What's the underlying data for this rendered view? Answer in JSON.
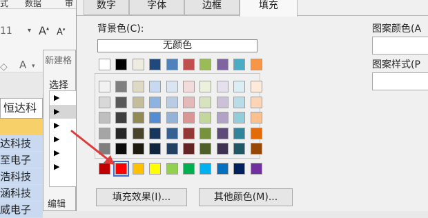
{
  "excel": {
    "ribbon_tabs": [
      "式",
      "数据",
      "审"
    ],
    "font_size": "11",
    "sub_dialog_title": "新建格",
    "sub_select_label": "选择",
    "sub_edit_label": "编辑",
    "cell_name": "恒达科",
    "cells": [
      "达科技",
      "至电子",
      "浩科技",
      "涵科技",
      "威电子"
    ]
  },
  "dialog": {
    "tabs": [
      {
        "label": "数字",
        "active": false
      },
      {
        "label": "字体",
        "active": false
      },
      {
        "label": "边框",
        "active": false
      },
      {
        "label": "填充",
        "active": true
      }
    ],
    "background_color_label": "背景色(C):",
    "no_color_label": "无颜色",
    "pattern_color_label": "图案颜色(A",
    "pattern_style_label": "图案样式(P",
    "fill_effects_button": "填充效果(I)...",
    "more_colors_button": "其他颜色(M)...",
    "palette_top": [
      "#ffffff",
      "#000000",
      "#eeece1",
      "#1f497d",
      "#4f81bd",
      "#c0504d",
      "#9bbb59",
      "#8064a2",
      "#4bacc6",
      "#f79646"
    ],
    "palette_shades": [
      [
        "#f2f2f2",
        "#7f7f7f",
        "#ddd9c3",
        "#c6d9f0",
        "#dbe5f1",
        "#f2dcdb",
        "#ebf1dd",
        "#e5e0ec",
        "#dbeef3",
        "#fdeada"
      ],
      [
        "#d8d8d8",
        "#595959",
        "#c4bd97",
        "#8db3e2",
        "#b8cce4",
        "#e5b9b7",
        "#d7e3bc",
        "#ccc1d9",
        "#b7dde8",
        "#fbd5b5"
      ],
      [
        "#bfbfbf",
        "#3f3f3f",
        "#938953",
        "#548dd4",
        "#95b3d7",
        "#d99694",
        "#c3d69b",
        "#b2a2c7",
        "#92cddc",
        "#fac08f"
      ],
      [
        "#a5a5a5",
        "#262626",
        "#494429",
        "#17365d",
        "#366092",
        "#953734",
        "#76923c",
        "#5f497a",
        "#31859b",
        "#e36c09"
      ],
      [
        "#7f7f7f",
        "#0c0c0c",
        "#1d1b10",
        "#0f243e",
        "#244061",
        "#632423",
        "#4f6128",
        "#3f3151",
        "#205867",
        "#974806"
      ]
    ],
    "palette_standard": [
      "#c00000",
      "#ff0000",
      "#ffc000",
      "#ffff00",
      "#92d050",
      "#00b050",
      "#00b0f0",
      "#0070c0",
      "#002060",
      "#7030a0"
    ],
    "selected_standard_color": "#ff0000",
    "annotation_arrow_color": "#e03a3a"
  }
}
